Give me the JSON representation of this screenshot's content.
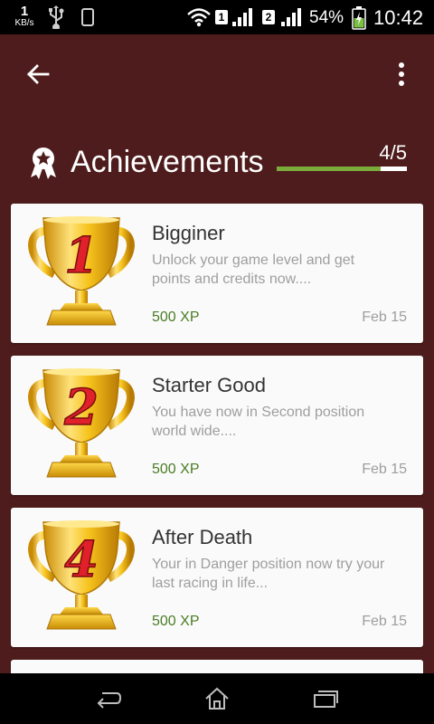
{
  "status_bar": {
    "net_speed_value": "1",
    "net_speed_unit": "KB/s",
    "sim1": "1",
    "sim2": "2",
    "battery_percent": "54%",
    "time": "10:42"
  },
  "header": {
    "title": "Achievements",
    "progress_text": "4/5",
    "progress_fraction": 0.8,
    "accent_color": "#7bab3a"
  },
  "achievements": [
    {
      "badge_number": "1",
      "title": "Bigginer",
      "description": "Unlock your game level and get points and credits now....",
      "xp": "500 XP",
      "date": "Feb 15"
    },
    {
      "badge_number": "2",
      "title": "Starter Good",
      "description": "You have now in Second position world wide....",
      "xp": "500 XP",
      "date": "Feb 15"
    },
    {
      "badge_number": "4",
      "title": "After Death",
      "description": "Your in Danger position now try your last racing in life...",
      "xp": "500 XP",
      "date": "Feb 15"
    }
  ],
  "colors": {
    "background": "#4e1c1c",
    "card": "#fafafa",
    "xp": "#4a7d24",
    "trophy_gold": "#f2c21b",
    "trophy_number": "#e0202a"
  }
}
